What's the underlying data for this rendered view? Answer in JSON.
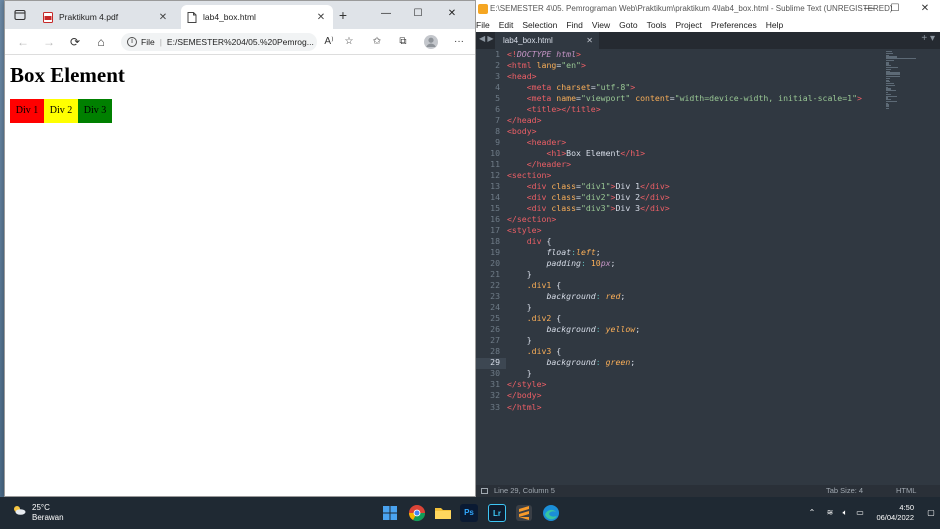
{
  "browser": {
    "tabs": [
      {
        "label": "Praktikum 4.pdf"
      },
      {
        "label": "lab4_box.html"
      }
    ],
    "url_prefix": "File",
    "url": "E:/SEMESTER%204/05.%20Pemrog...",
    "page": {
      "heading": "Box Element",
      "boxes": [
        {
          "label": "Div 1",
          "color": "#ff0000"
        },
        {
          "label": "Div 2",
          "color": "#ffff00"
        },
        {
          "label": "Div 3",
          "color": "#008000"
        }
      ]
    }
  },
  "sublime": {
    "title": "E:\\SEMESTER 4\\05. Pemrograman Web\\Praktikum\\praktikum 4\\lab4_box.html - Sublime Text (UNREGISTERED)",
    "menu": [
      "File",
      "Edit",
      "Selection",
      "Find",
      "View",
      "Goto",
      "Tools",
      "Project",
      "Preferences",
      "Help"
    ],
    "tab": "lab4_box.html",
    "current_line": 29,
    "status": {
      "position": "Line 29, Column 5",
      "tab_size": "Tab Size: 4",
      "syntax": "HTML"
    },
    "code": [
      [
        [
          "tg",
          "<!"
        ],
        [
          "kw",
          "DOCTYPE"
        ],
        [
          "",
          ""
        ],
        [
          "kw",
          " html"
        ],
        [
          "tg",
          ">"
        ]
      ],
      [
        [
          "tg",
          "<html"
        ],
        [
          "at",
          " lang"
        ],
        [
          "",
          "="
        ],
        [
          "st",
          "\"en\""
        ],
        [
          "tg",
          ">"
        ]
      ],
      [
        [
          "tg",
          "<head>"
        ]
      ],
      [
        [
          "",
          "    "
        ],
        [
          "tg",
          "<meta"
        ],
        [
          "at",
          " charset"
        ],
        [
          "",
          "="
        ],
        [
          "st",
          "\"utf-8\""
        ],
        [
          "tg",
          ">"
        ]
      ],
      [
        [
          "",
          "    "
        ],
        [
          "tg",
          "<meta"
        ],
        [
          "at",
          " name"
        ],
        [
          "",
          "="
        ],
        [
          "st",
          "\"viewport\""
        ],
        [
          "at",
          " content"
        ],
        [
          "",
          "="
        ],
        [
          "st",
          "\"width=device-width, initial-scale=1\""
        ],
        [
          "tg",
          ">"
        ]
      ],
      [
        [
          "",
          "    "
        ],
        [
          "tg",
          "<title></title>"
        ]
      ],
      [
        [
          "tg",
          "</head>"
        ]
      ],
      [
        [
          "tg",
          "<body>"
        ]
      ],
      [
        [
          "",
          "    "
        ],
        [
          "tg",
          "<header>"
        ]
      ],
      [
        [
          "",
          "        "
        ],
        [
          "tg",
          "<h1>"
        ],
        [
          "",
          "Box Element"
        ],
        [
          "tg",
          "</h1>"
        ]
      ],
      [
        [
          "",
          "    "
        ],
        [
          "tg",
          "</header>"
        ]
      ],
      [
        [
          "tg",
          "<section>"
        ]
      ],
      [
        [
          "",
          "    "
        ],
        [
          "tg",
          "<div"
        ],
        [
          "at",
          " class"
        ],
        [
          "",
          "="
        ],
        [
          "st",
          "\"div1\""
        ],
        [
          "tg",
          ">"
        ],
        [
          "",
          "Div 1"
        ],
        [
          "tg",
          "</div>"
        ]
      ],
      [
        [
          "",
          "    "
        ],
        [
          "tg",
          "<div"
        ],
        [
          "at",
          " class"
        ],
        [
          "",
          "="
        ],
        [
          "st",
          "\"div2\""
        ],
        [
          "tg",
          ">"
        ],
        [
          "",
          "Div 2"
        ],
        [
          "tg",
          "</div>"
        ]
      ],
      [
        [
          "",
          "    "
        ],
        [
          "tg",
          "<div"
        ],
        [
          "at",
          " class"
        ],
        [
          "",
          "="
        ],
        [
          "st",
          "\"div3\""
        ],
        [
          "tg",
          ">"
        ],
        [
          "",
          "Div 3"
        ],
        [
          "tg",
          "</div>"
        ]
      ],
      [
        [
          "tg",
          "</section>"
        ]
      ],
      [
        [
          "tg",
          "<style>"
        ]
      ],
      [
        [
          "",
          "    "
        ],
        [
          "tg",
          "div"
        ],
        [
          "",
          " {"
        ]
      ],
      [
        [
          "",
          "        "
        ],
        [
          "pr",
          "float"
        ],
        [
          "pu",
          ":"
        ],
        [
          "vl",
          "left"
        ],
        [
          "",
          ";"
        ]
      ],
      [
        [
          "",
          "        "
        ],
        [
          "pr",
          "padding"
        ],
        [
          "pu",
          ":"
        ],
        [
          "sel",
          " 10"
        ],
        [
          "kw",
          "px"
        ],
        [
          "",
          ";"
        ]
      ],
      [
        [
          "",
          "    }"
        ]
      ],
      [
        [
          "",
          "    "
        ],
        [
          "sel",
          ".div1"
        ],
        [
          "",
          " {"
        ]
      ],
      [
        [
          "",
          "        "
        ],
        [
          "pr",
          "background"
        ],
        [
          "pu",
          ":"
        ],
        [
          "vl",
          " red"
        ],
        [
          "",
          ";"
        ]
      ],
      [
        [
          "",
          "    }"
        ]
      ],
      [
        [
          "",
          "    "
        ],
        [
          "sel",
          ".div2"
        ],
        [
          "",
          " {"
        ]
      ],
      [
        [
          "",
          "        "
        ],
        [
          "pr",
          "background"
        ],
        [
          "pu",
          ":"
        ],
        [
          "vl",
          " yellow"
        ],
        [
          "",
          ";"
        ]
      ],
      [
        [
          "",
          "    }"
        ]
      ],
      [
        [
          "",
          "    "
        ],
        [
          "sel",
          ".div3"
        ],
        [
          "",
          " {"
        ]
      ],
      [
        [
          "",
          "        "
        ],
        [
          "pr",
          "background"
        ],
        [
          "pu",
          ":"
        ],
        [
          "vl",
          " green"
        ],
        [
          "",
          ";"
        ]
      ],
      [
        [
          "",
          "    }"
        ]
      ],
      [
        [
          "tg",
          "</style>"
        ]
      ],
      [
        [
          "tg",
          "</body>"
        ]
      ],
      [
        [
          "tg",
          "</html>"
        ]
      ]
    ]
  },
  "taskbar": {
    "weather_temp": "25°C",
    "weather_desc": "Berawan",
    "apps": [
      {
        "name": "start",
        "icon": "windows-logo-icon"
      },
      {
        "name": "chrome",
        "icon": "chrome-icon"
      },
      {
        "name": "explorer",
        "icon": "folder-icon"
      },
      {
        "name": "photoshop",
        "icon": "photoshop-icon",
        "label": "Ps"
      },
      {
        "name": "lightroom",
        "icon": "lightroom-icon",
        "label": "Lr"
      },
      {
        "name": "sublime",
        "icon": "sublime-icon"
      },
      {
        "name": "edge",
        "icon": "edge-icon"
      }
    ],
    "time": "4:50",
    "date": "06/04/2022"
  }
}
